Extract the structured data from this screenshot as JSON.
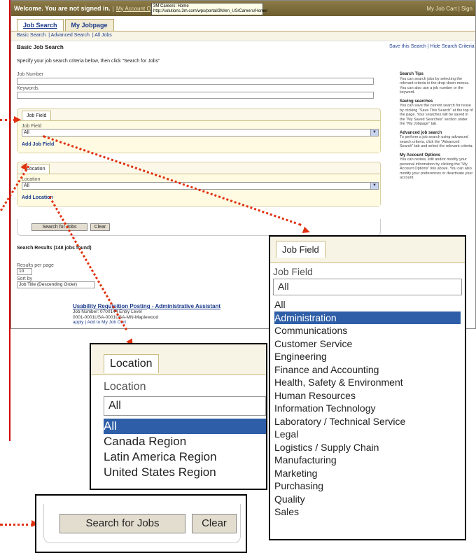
{
  "browser": {
    "welcome": "Welcome. You are not signed in.",
    "account_link": "My Account Options",
    "tooltip_line1": "3M Careers: Home",
    "tooltip_line2": "http://solutions.3m.com/wps/portal/3M/en_US/Careers/Home/",
    "right_links": "My Job Cart | Sign"
  },
  "tabs": [
    "Job Search",
    "My Jobpage"
  ],
  "subnav": [
    "Basic Search",
    "Advanced Search",
    "All Jobs"
  ],
  "page": {
    "title": "Basic Job Search",
    "save_links": "Save this Search | Hide Search Criteria",
    "intro": "Specify your job search criteria below, then click \"Search for Jobs\"",
    "job_number_label": "Job Number",
    "keywords_label": "Keywords"
  },
  "job_field_panel": {
    "tab": "Job Field",
    "label": "Job Field",
    "value": "All",
    "add": "Add Job Field"
  },
  "location_panel": {
    "tab": "Location",
    "label": "Location",
    "value": "All",
    "add": "Add Location"
  },
  "buttons": {
    "search": "Search for Jobs",
    "clear": "Clear"
  },
  "tips": {
    "t1": "Search Tips",
    "b1": "You can search jobs by selecting the relevant criteria in the drop-down menus. You can also use a job number or the keyword.",
    "t2": "Saving searches",
    "b2": "You can save the current search for reuse by clicking \"Save This Search\" at the top of the page. Your searches will be saved in the \"My Saved Searches\" section under the \"My Jobpage\" tab.",
    "t3": "Advanced job search",
    "b3": "To perform a job search using advanced search criteria, click the \"Advanced Search\" tab and select the relevant criteria.",
    "t4": "My Account Options",
    "b4": "You can review, edit and/or modify your personal information by clicking the \"My Account Options\" link above. You can also modify your preferences or deactivate your account."
  },
  "results": {
    "header": "Search Results (148 jobs found)",
    "per_page_label": "Results per page",
    "per_page": "10",
    "sort_label": "Sort by",
    "sort_value": "Job Title (Descending Order)",
    "job_title": "Usability Requisition Posting - Administrative Assistant",
    "job_number": "Job Number: 0700144 Entry Level",
    "job_location": "0001-0001USA-0001USA-MN-Maplewood",
    "job_actions": "apply | Add to My Job Cart"
  },
  "callout_jobfield": {
    "tab": "Job Field",
    "label": "Job Field",
    "value": "All",
    "options": [
      "All",
      "Administration",
      "Communications",
      "Customer Service",
      "Engineering",
      "Finance and Accounting",
      "Health, Safety & Environment",
      "Human Resources",
      "Information Technology",
      "Laboratory / Technical Service",
      "Legal",
      "Logistics / Supply Chain",
      "Manufacturing",
      "Marketing",
      "Purchasing",
      "Quality",
      "Sales"
    ],
    "selected_index": 1
  },
  "callout_location": {
    "tab": "Location",
    "label": "Location",
    "value": "All",
    "options": [
      "All",
      "Canada Region",
      "Latin America Region",
      "United States Region"
    ],
    "selected_index": 0
  },
  "callout_buttons": {
    "search": "Search for Jobs",
    "clear": "Clear"
  },
  "colors": {
    "accent": "#e03010",
    "highlight": "#2d5ea7",
    "panel": "#fbf8ea"
  }
}
